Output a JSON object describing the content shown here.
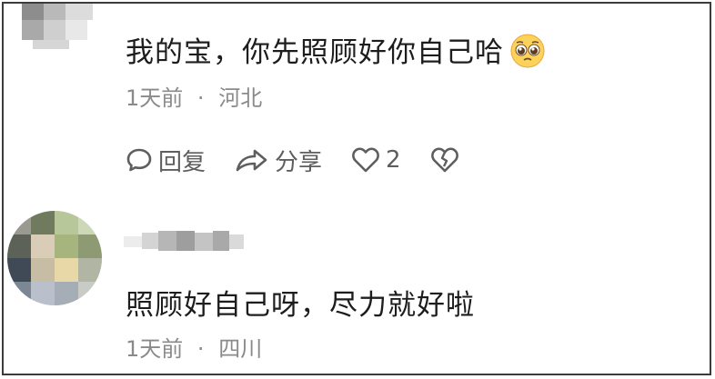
{
  "comments": [
    {
      "text": "我的宝，你先照顾好你自己哈",
      "emoji": "pleading-face-emoji",
      "time": "1天前",
      "separator": "·",
      "location": "河北",
      "actions": {
        "reply_label": "回复",
        "share_label": "分享",
        "like_count": "2"
      }
    },
    {
      "text": "照顾好自己呀，尽力就好啦",
      "time": "1天前",
      "separator": "·",
      "location": "四川"
    }
  ],
  "colors": {
    "text": "#1d1d1d",
    "meta": "#8a8a8a",
    "icon": "#5e5e5e",
    "border": "#3c3c3c"
  },
  "icons": [
    "comment-bubble-icon",
    "share-arrow-icon",
    "heart-icon",
    "broken-heart-icon"
  ]
}
